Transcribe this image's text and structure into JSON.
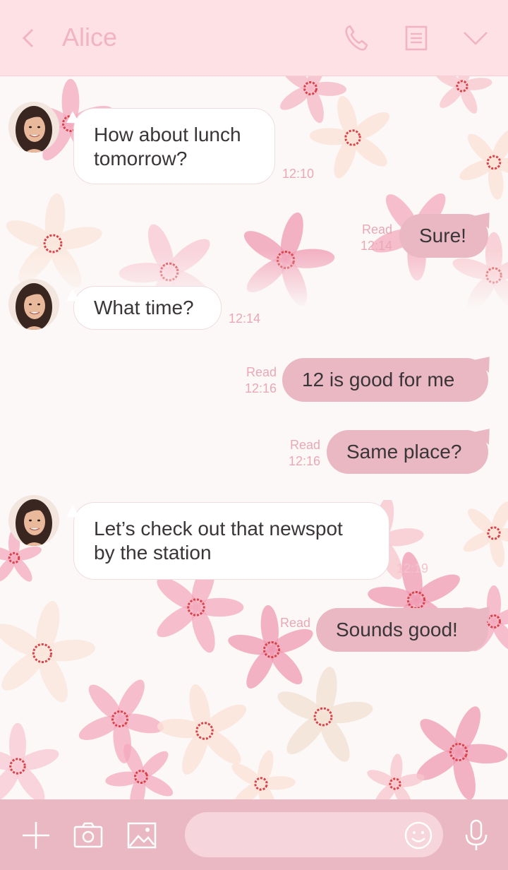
{
  "header": {
    "title": "Alice",
    "icons": {
      "back": "chevron-left-icon",
      "call": "phone-icon",
      "notes": "document-icon",
      "menu": "chevron-down-icon"
    }
  },
  "messages": [
    {
      "from": "contact",
      "text": "How about lunch tomorrow?",
      "line1": "How about lunch",
      "line2": "tomorrow?",
      "time": "12:10"
    },
    {
      "from": "me",
      "text": "Sure!",
      "status": "Read",
      "time": "12:14"
    },
    {
      "from": "contact",
      "text": "What time?",
      "time": "12:14"
    },
    {
      "from": "me",
      "text": "12 is good for me",
      "status": "Read",
      "time": "12:16"
    },
    {
      "from": "me",
      "text": "Same place?",
      "status": "Read",
      "time": "12:16"
    },
    {
      "from": "contact",
      "text": "Let's check out that newspot by the station",
      "line1": "Let’s check out that newspot",
      "line2": "by the station",
      "time": "12:19"
    },
    {
      "from": "me",
      "text": "Sounds good!",
      "status": "Read"
    }
  ],
  "footer": {
    "input_value": "",
    "icons": {
      "add": "plus-icon",
      "camera": "camera-icon",
      "gallery": "image-icon",
      "emoji": "smiley-icon",
      "voice": "microphone-icon"
    }
  },
  "colors": {
    "header_bg": "#fde1e5",
    "accent_pink": "#e9b8c3",
    "muted_text": "#eaa8b6",
    "incoming_bubble": "#ffffff",
    "background": "#fbf8f7"
  }
}
